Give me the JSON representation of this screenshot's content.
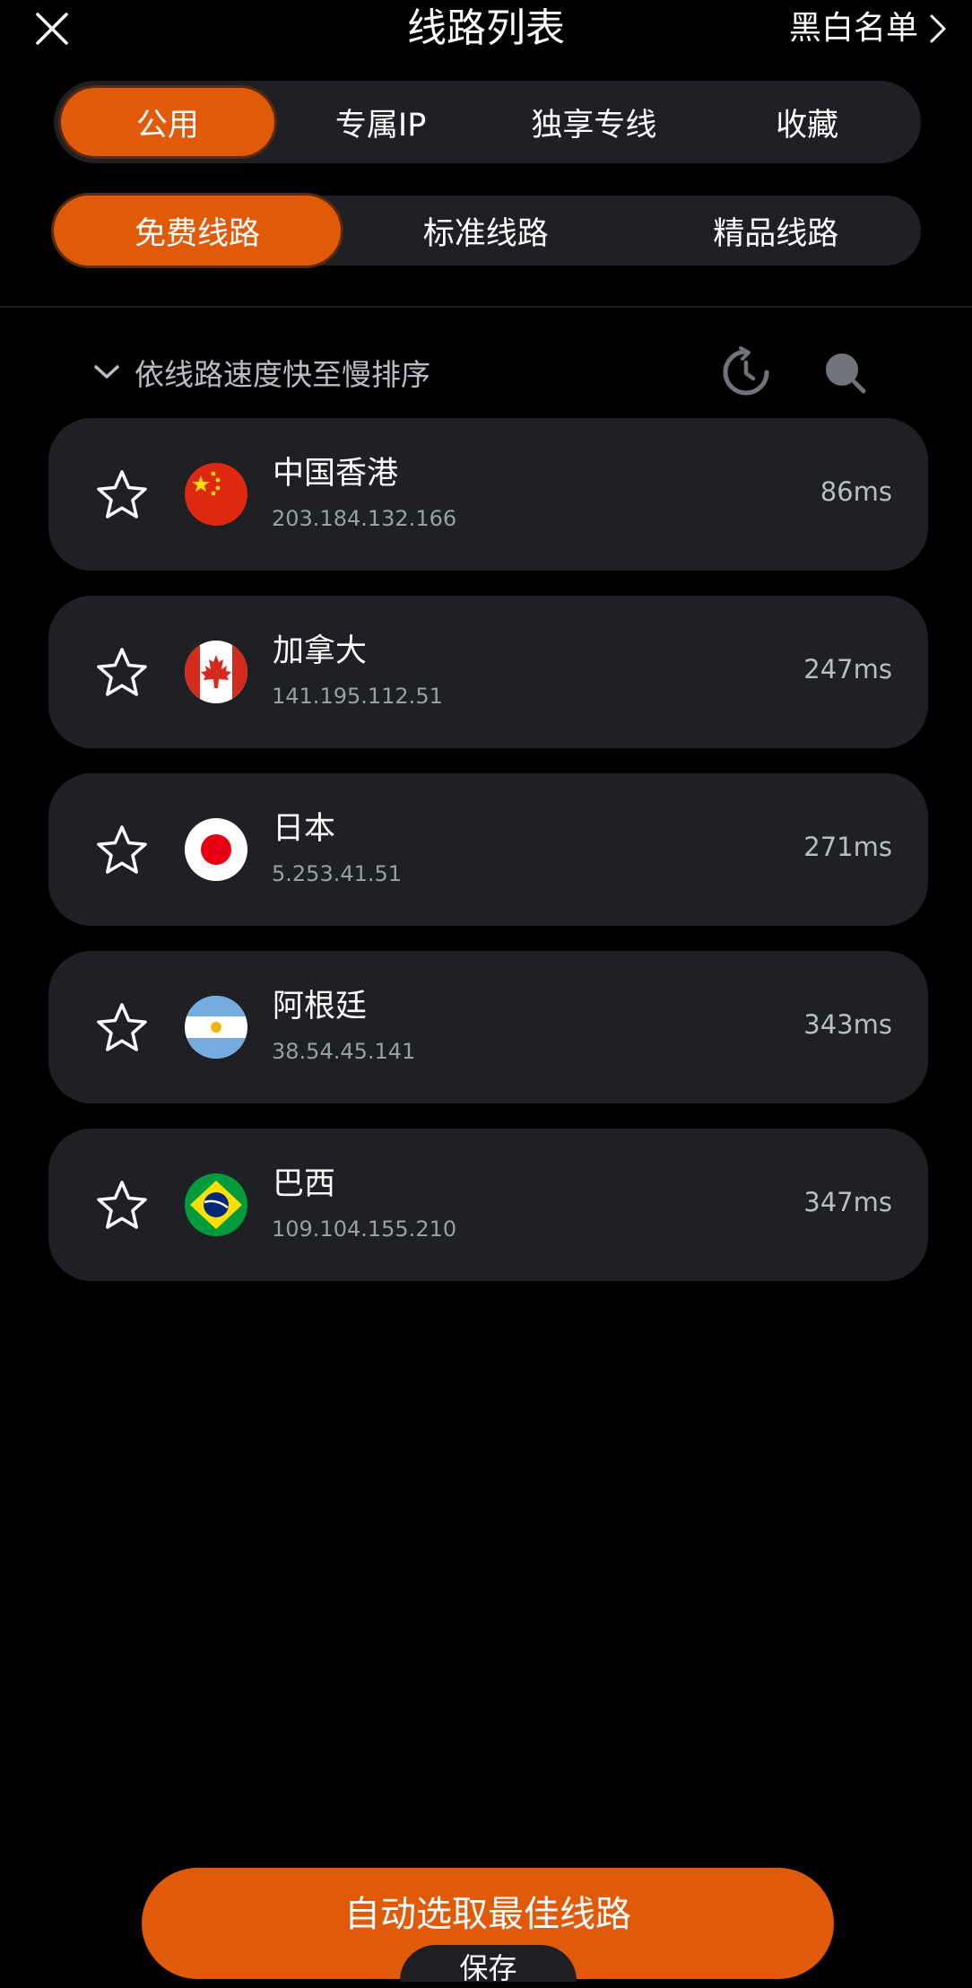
{
  "header": {
    "title": "线路列表",
    "right_link": "黑白名单",
    "close_icon": "close-icon",
    "chevron_icon": "chevron-right-icon"
  },
  "tabs_primary": [
    {
      "label": "公用",
      "active": true
    },
    {
      "label": "专属IP",
      "active": false
    },
    {
      "label": "独享专线",
      "active": false
    },
    {
      "label": "收藏",
      "active": false
    }
  ],
  "tabs_secondary": [
    {
      "label": "免费线路",
      "active": true
    },
    {
      "label": "标准线路",
      "active": false
    },
    {
      "label": "精品线路",
      "active": false
    }
  ],
  "sort": {
    "label": "依线路速度快至慢排序",
    "icon": "chevron-down-icon"
  },
  "routes": [
    {
      "name": "中国香港",
      "ip": "203.184.132.166",
      "latency": "86ms",
      "flag": "china-flag-icon",
      "favorited": false
    },
    {
      "name": "加拿大",
      "ip": "141.195.112.51",
      "latency": "247ms",
      "flag": "canada-flag-icon",
      "favorited": false
    },
    {
      "name": "日本",
      "ip": "5.253.41.51",
      "latency": "271ms",
      "flag": "japan-flag-icon",
      "favorited": false
    },
    {
      "name": "阿根廷",
      "ip": "38.54.45.141",
      "latency": "343ms",
      "flag": "argentina-flag-icon",
      "favorited": false
    },
    {
      "name": "巴西",
      "ip": "109.104.155.210",
      "latency": "347ms",
      "flag": "brazil-flag-icon",
      "favorited": false
    }
  ],
  "actions": {
    "auto_select": "自动选取最佳线路",
    "save": "保存"
  },
  "colors": {
    "accent": "#e05a0a",
    "background": "#000000",
    "card": "#1f2024",
    "muted_text": "#9a9ea6"
  }
}
